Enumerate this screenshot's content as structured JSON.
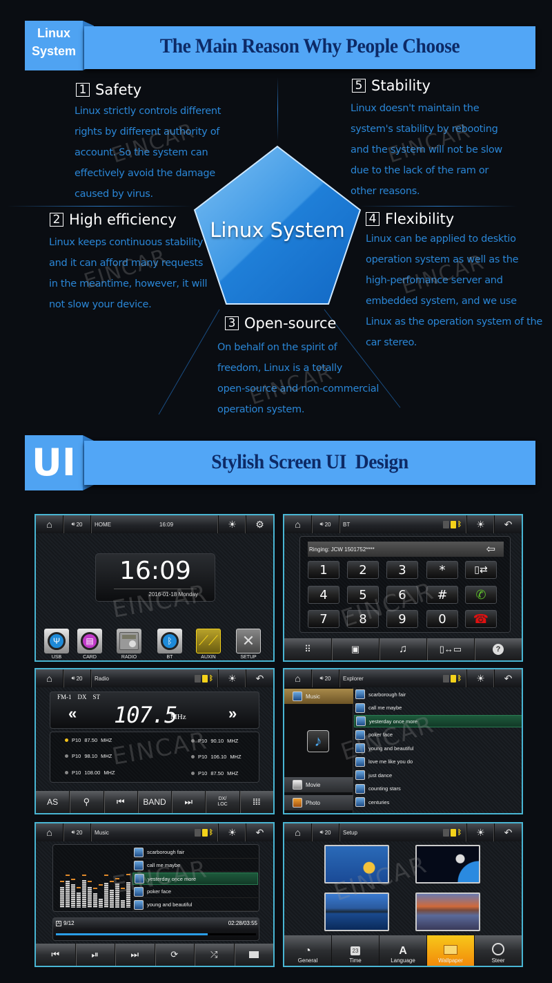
{
  "section_linux": {
    "cube_label_line1": "Linux",
    "cube_label_line2": "System",
    "banner_title": "The Main Reason Why People Choose",
    "center_label": "Linux System",
    "features": [
      {
        "number": "1",
        "title": "Safety",
        "text": "Linux strictly controls different\nrights by different authority of\naccount. So the system can\neffectively avoid the damage\ncaused by virus."
      },
      {
        "number": "2",
        "title": "High efficiency",
        "text": "Linux keeps continuous stability\nand it can afford many requests\nin the meantime, however, it will\nnot slow your device."
      },
      {
        "number": "3",
        "title": "Open-source",
        "text": " On behalf on the spirit of\nfreedom, Linux is a totally\nopen-source and non-commercial\noperation system."
      },
      {
        "number": "4",
        "title": "Flexibility",
        "text": "Linux can be applied to desktio\noperation system as well as the\nhigh-perfomance server and\nembedded system, and we use\nLinux as the operation system of the\ncar stereo."
      },
      {
        "number": "5",
        "title": "Stability",
        "text": "Linux doesn't maintain the\nsystem's stability by rebooting\nand the system will not be slow\ndue to the lack of the ram or\nother reasons."
      }
    ]
  },
  "section_ui": {
    "cube_label": "UI",
    "banner_title": "Stylish Screen UI  Design"
  },
  "watermark": "EINCAR",
  "watermark_mark": "®",
  "common": {
    "volume": "20",
    "home_icon": "home-icon",
    "volume_icon": "volume-icon",
    "brightness_icon": "brightness-icon",
    "back_icon": "back-icon"
  },
  "screens": {
    "home": {
      "title": "HOME",
      "time_small": "16:09",
      "clock": "16:09",
      "date": "2016-01-18 Monday",
      "apps": [
        {
          "label": "USB",
          "icon": "usb-icon"
        },
        {
          "label": "CARD",
          "icon": "sd-card-icon"
        },
        {
          "label": "RADIO",
          "icon": "radio-icon"
        },
        {
          "label": "BT",
          "icon": "bluetooth-icon"
        },
        {
          "label": "AUXIN",
          "icon": "aux-cable-icon"
        },
        {
          "label": "SETUP",
          "icon": "tools-icon"
        }
      ]
    },
    "bt": {
      "title": "BT",
      "display": "Ringing: JCW 1501752****",
      "keys": [
        "1",
        "2",
        "3",
        "*",
        "4",
        "5",
        "6",
        "#",
        "7",
        "8",
        "9",
        "0"
      ],
      "bottom_icons": [
        "keypad-icon",
        "phonebook-icon",
        "music-note-icon",
        "phone-link-icon",
        "help-icon"
      ]
    },
    "radio": {
      "title": "Radio",
      "band": "FM-1",
      "dx": "DX",
      "st": "ST",
      "frequency": "107.5",
      "unit": "MHz",
      "presets": [
        {
          "label": "P10",
          "freq": "87.50",
          "unit": "MHZ",
          "active": true
        },
        {
          "label": "P10",
          "freq": "98.10",
          "unit": "MHZ",
          "active": false
        },
        {
          "label": "P10",
          "freq": "108.00",
          "unit": "MHZ",
          "active": false
        },
        {
          "label": "P10",
          "freq": "90.10",
          "unit": "MHZ",
          "active": false
        },
        {
          "label": "P10",
          "freq": "106.10",
          "unit": "MHZ",
          "active": false
        },
        {
          "label": "P10",
          "freq": "87.50",
          "unit": "MHZ",
          "active": false
        }
      ],
      "buttons": [
        "AS",
        "",
        "",
        "BAND",
        "",
        "DX/\nLOC",
        ""
      ]
    },
    "explorer": {
      "title": "Explorer",
      "categories": [
        "Music",
        "Movie",
        "Photo"
      ],
      "tracks": [
        "scarborough fair",
        "call me maybe",
        "yesterday once more",
        "poker face",
        "young and beautiful",
        "love me like you do",
        "just dance",
        "counting stars",
        "centuries"
      ],
      "selected_index": 2
    },
    "music": {
      "title": "Music",
      "tracks": [
        "scarborough fair",
        "call me maybe",
        "yesterday once more",
        "poker face",
        "young and beautiful"
      ],
      "selected_index": 2,
      "track_count": "9/12",
      "time": "02:28/03:55",
      "progress": 0.76,
      "eq_levels": [
        0.6,
        0.78,
        0.68,
        0.45,
        0.8,
        0.6,
        0.42,
        0.26,
        0.72,
        0.52,
        0.7,
        0.22,
        0.75
      ],
      "eq_peaks": [
        0.72,
        0.9,
        0.78,
        0.55,
        0.9,
        0.72,
        0.52,
        0.62,
        0.9,
        0.72,
        0.8,
        0.52,
        0.92
      ]
    },
    "setup": {
      "title": "Setup",
      "tabs": [
        "General",
        "Time",
        "Language",
        "Wallpaper",
        "Steer"
      ],
      "active_tab": "Wallpaper",
      "calendar_day": "23"
    }
  },
  "colors": {
    "banner": "#52a6f6",
    "banner_text": "#0d2a66",
    "feature_text": "#2a86d6",
    "screen_border": "#49b6d4",
    "accent_yellow": "#f4d21a"
  }
}
